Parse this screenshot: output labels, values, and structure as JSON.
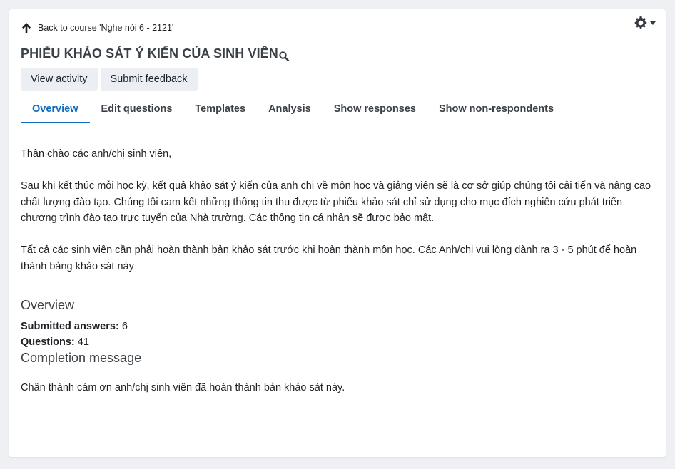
{
  "nav": {
    "back_label": "Back to course 'Nghe nói 6 - 2121'"
  },
  "header": {
    "title": "PHIẾU KHẢO SÁT Ý KIẾN CỦA SINH VIÊN",
    "buttons": [
      "View activity",
      "Submit feedback"
    ]
  },
  "tabs": [
    {
      "label": "Overview",
      "active": true
    },
    {
      "label": "Edit questions",
      "active": false
    },
    {
      "label": "Templates",
      "active": false
    },
    {
      "label": "Analysis",
      "active": false
    },
    {
      "label": "Show responses",
      "active": false
    },
    {
      "label": "Show non-respondents",
      "active": false
    }
  ],
  "intro": {
    "greeting": "Thân chào các anh/chị sinh viên,",
    "paragraph1": "Sau khi kết thúc mỗi học kỳ, kết quả khảo sát ý kiến của anh chị về môn học và giảng viên sẽ là cơ sở giúp chúng tôi cải tiến và nâng cao chất lượng đào tạo. Chúng tôi cam kết những thông tin thu được từ phiếu khảo sát chỉ sử dụng cho mục đích nghiên cứu phát triển chương trình đào tạo trực tuyến của Nhà trường. Các thông tin cá nhân sẽ được bảo mật.",
    "paragraph2": "Tất cả các sinh viên cần phải hoàn thành bản khảo sát trước khi hoàn thành môn học. Các Anh/chị vui lòng dành ra 3 - 5 phút để hoàn thành bảng khảo sát này"
  },
  "overview": {
    "heading": "Overview",
    "submitted_label": "Submitted answers:",
    "submitted_value": "6",
    "questions_label": "Questions:",
    "questions_value": "41"
  },
  "completion": {
    "heading": "Completion message",
    "text": "Chân thành cám ơn anh/chị sinh viên đã hoàn thành bản khảo sát này."
  },
  "colors": {
    "accent": "#0f6cbf",
    "button_bg": "#ebeef2",
    "page_bg": "#eef0f3"
  },
  "icons": {
    "back": "arrow-up-icon",
    "settings": "gear-icon",
    "title_zoom": "search-icon"
  }
}
